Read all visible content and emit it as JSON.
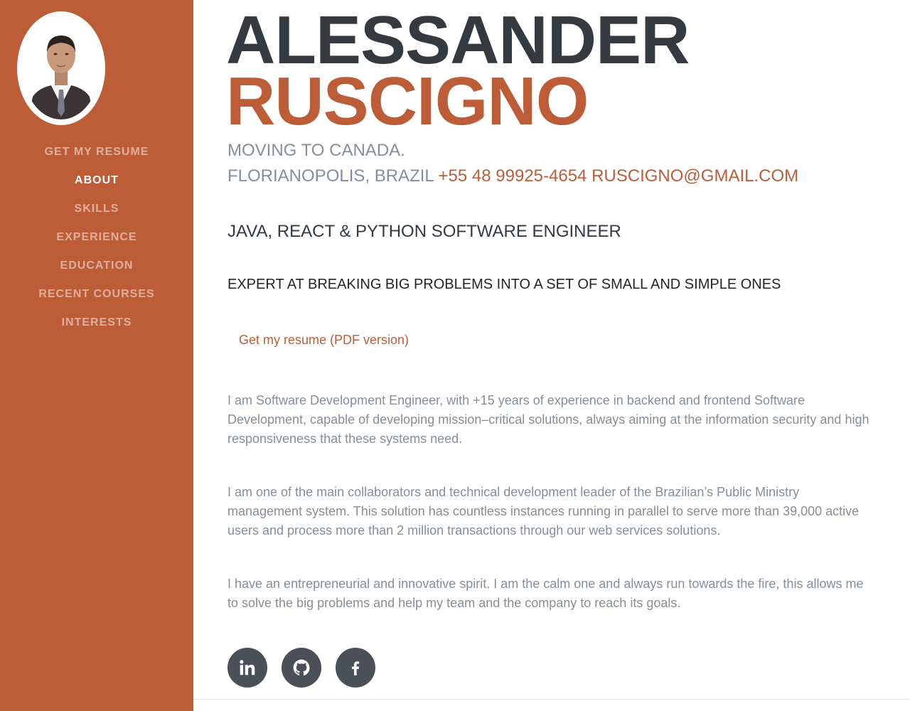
{
  "sidebar": {
    "nav": [
      {
        "label": "GET MY RESUME"
      },
      {
        "label": "ABOUT"
      },
      {
        "label": "SKILLS"
      },
      {
        "label": "EXPERIENCE"
      },
      {
        "label": "EDUCATION"
      },
      {
        "label": "RECENT COURSES"
      },
      {
        "label": "INTERESTS"
      }
    ],
    "active": "ABOUT"
  },
  "profile": {
    "first_name": "ALESSANDER",
    "last_name": "RUSCIGNO",
    "status": "MOVING TO CANADA.",
    "location": "FLORIANOPOLIS, BRAZIL",
    "phone": "+55 48 99925-4654",
    "email": "RUSCIGNO@GMAIL.COM",
    "role": "JAVA, REACT & PYTHON SOFTWARE ENGINEER",
    "tagline": "EXPERT AT BREAKING BIG PROBLEMS INTO A SET OF SMALL AND SIMPLE ONES"
  },
  "resume_link": "Get my resume (PDF version)",
  "about": [
    "I am Software Development Engineer, with +15 years of experience in backend and frontend Software Development, capable of developing mission–critical solutions, always aiming at the information security and high responsiveness that these systems need.",
    "I am one of the main collaborators and technical development leader of the Brazilian’s Public Ministry management system. This solution has countless instances running in parallel to serve more than 39,000 active users and process more than 2 million transactions through our web services solutions.",
    "I have an entrepreneurial and innovative spirit. I am the calm one and always run towards the fire, this allows me to solve the big problems and help my team and the company to reach its goals."
  ],
  "social": [
    {
      "icon": "linkedin-icon"
    },
    {
      "icon": "github-icon"
    },
    {
      "icon": "facebook-icon"
    }
  ],
  "colors": {
    "primary": "#bd5d38",
    "dark": "#343a40",
    "muted": "#868e96",
    "social_bg": "#495057"
  }
}
